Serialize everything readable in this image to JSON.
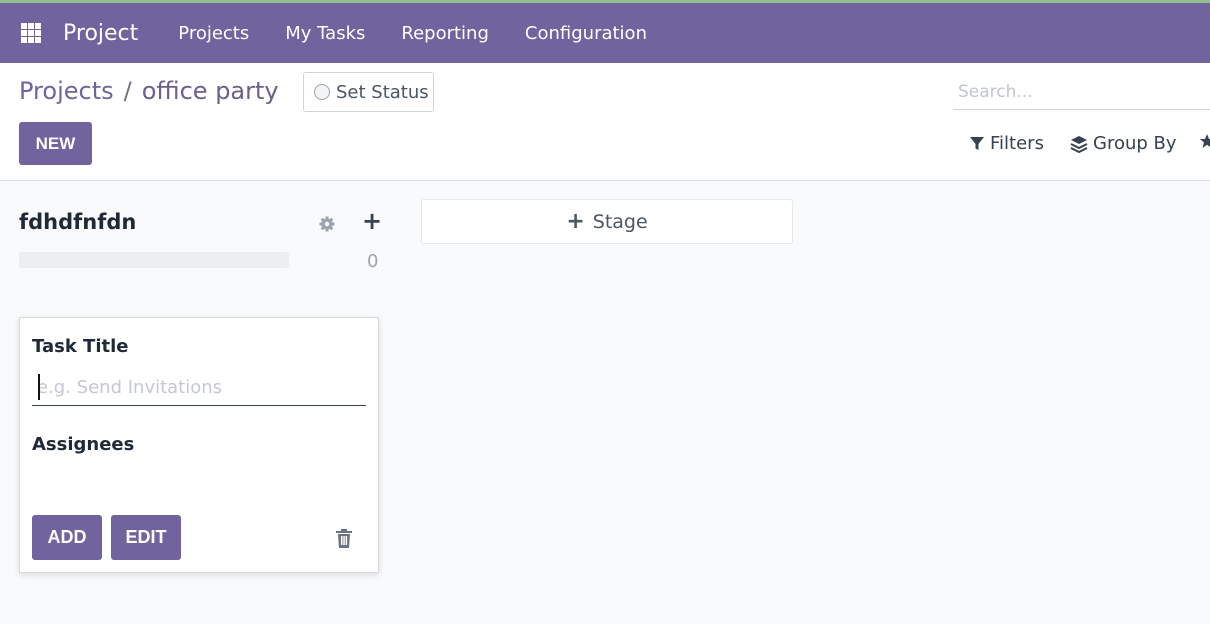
{
  "navbar": {
    "apps_icon": "grid-icon",
    "brand": "Project",
    "items": [
      "Projects",
      "My Tasks",
      "Reporting",
      "Configuration"
    ]
  },
  "control_panel": {
    "breadcrumb_parent": "Projects",
    "breadcrumb_separator": "/",
    "breadcrumb_current": "office party",
    "set_status": "Set Status",
    "new_button": "NEW",
    "search_placeholder": "Search...",
    "filters": "Filters",
    "group_by": "Group By"
  },
  "kanban": {
    "column_title": "fdhdfnfdn",
    "column_count": "0",
    "add_stage": "Stage"
  },
  "quick_create": {
    "task_title_label": "Task Title",
    "task_title_placeholder": "e.g. Send Invitations",
    "task_title_value": "",
    "assignees_label": "Assignees",
    "add_button": "ADD",
    "edit_button": "EDIT"
  },
  "colors": {
    "brand": "#71639e",
    "background": "#f9fafb"
  }
}
